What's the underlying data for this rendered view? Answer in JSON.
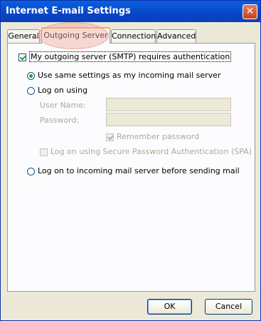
{
  "window": {
    "title": "Internet E-mail Settings",
    "close_glyph": "✕"
  },
  "tabs": [
    {
      "label": "General"
    },
    {
      "label": "Outgoing Server"
    },
    {
      "label": "Connection"
    },
    {
      "label": "Advanced"
    }
  ],
  "active_tab": "Outgoing Server",
  "outgoing": {
    "smtp_auth_label": "My outgoing server (SMTP) requires authentication",
    "smtp_auth_checked": true,
    "use_same_label": "Use same settings as my incoming mail server",
    "use_same_selected": true,
    "log_on_using_label": "Log on using",
    "user_name_label": "User Name:",
    "user_name_value": "",
    "password_label": "Password:",
    "password_value": "",
    "remember_password_label": "Remember password",
    "remember_password_checked": true,
    "spa_label": "Log on using Secure Password Authentication (SPA)",
    "spa_checked": false,
    "log_on_incoming_label": "Log on to incoming mail server before sending mail"
  },
  "buttons": {
    "ok": "OK",
    "cancel": "Cancel"
  },
  "colors": {
    "titlebar": "#0846c8",
    "active_tab_accent": "#f5a93a",
    "check": "#21a121"
  },
  "icons": {
    "close": "close-icon"
  }
}
